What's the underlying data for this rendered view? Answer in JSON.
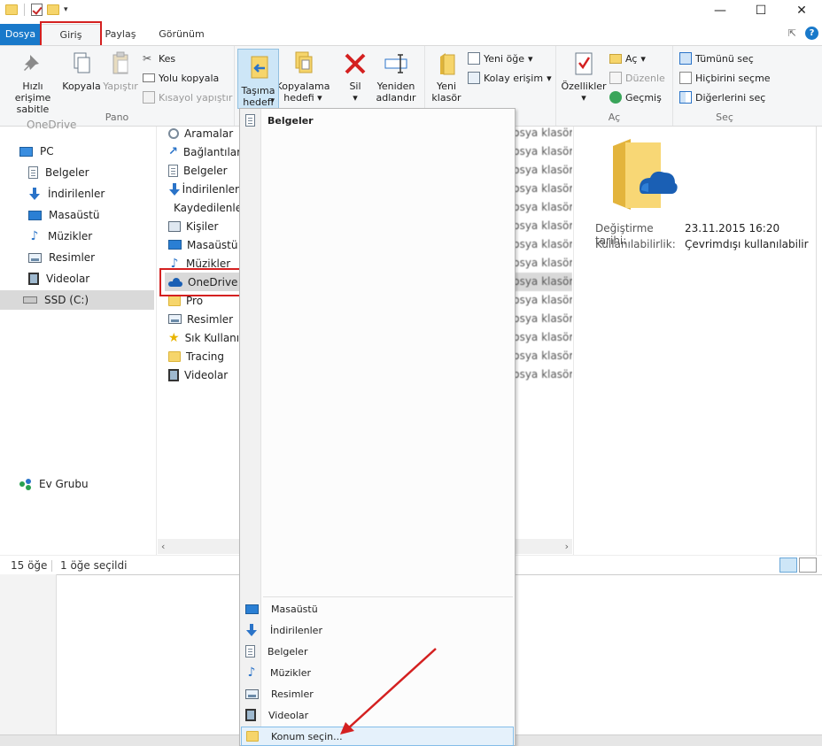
{
  "qat": {
    "dropdown": "▾"
  },
  "window_buttons": {
    "minimize": "—",
    "maximize": "☐",
    "close": "✕"
  },
  "tabs": {
    "file": "Dosya",
    "home": "Giriş",
    "share": "Paylaş",
    "view": "Görünüm"
  },
  "ribbon": {
    "pin": "Hızlı erişime sabitle",
    "copy": "Kopyala",
    "paste": "Yapıştır",
    "cut": "Kes",
    "copy_path": "Yolu kopyala",
    "paste_shortcut": "Kısayol yapıştır",
    "group_clipboard": "Pano",
    "move_to": "Taşıma hedefi",
    "copy_to": "Kopyalama hedefi",
    "delete": "Sil",
    "rename": "Yeniden adlandır",
    "new_folder": "Yeni klasör",
    "new_item": "Yeni öğe",
    "easy_access": "Kolay erişim",
    "properties": "Özellikler",
    "open": "Aç",
    "edit": "Düzenle",
    "history": "Geçmiş",
    "group_open": "Aç",
    "select_all": "Tümünü seç",
    "select_none": "Hiçbirini seçme",
    "invert_selection": "Diğerlerini seç",
    "group_select": "Seç"
  },
  "nav": {
    "partial": "OneDrive",
    "pc": "PC",
    "items": [
      "Belgeler",
      "İndirilenler",
      "Masaüstü",
      "Müzikler",
      "Resimler",
      "Videolar"
    ],
    "drive": "SSD (C:)",
    "homegroup": "Ev Grubu"
  },
  "files": [
    "Aramalar",
    "Bağlantılar",
    "Belgeler",
    "İndirilenler",
    "Kaydedilenler",
    "Kişiler",
    "Masaüstü",
    "Müzikler",
    "OneDrive",
    "Pro",
    "Resimler",
    "Sık Kullanılanlar",
    "Tracing",
    "Videolar"
  ],
  "type_label": "Dosya klasörü",
  "details": {
    "modified_label": "Değiştirme tarihi:",
    "modified_value": "23.11.2015 16:20",
    "availability_label": "Kullanılabilirlik:",
    "availability_value": "Çevrimdışı kullanılabilir"
  },
  "status": {
    "count": "15 öğe",
    "selected": "1 öğe seçildi"
  },
  "menu": {
    "recent": "Belgeler",
    "items": [
      "Masaüstü",
      "İndirilenler",
      "Belgeler",
      "Müzikler",
      "Resimler",
      "Videolar"
    ],
    "choose_location": "Konum seçin..."
  },
  "colors": {
    "accent": "#1979ca",
    "annotation": "#d42020",
    "folder": "#f6d56b",
    "onedrive": "#1a5fb4"
  }
}
